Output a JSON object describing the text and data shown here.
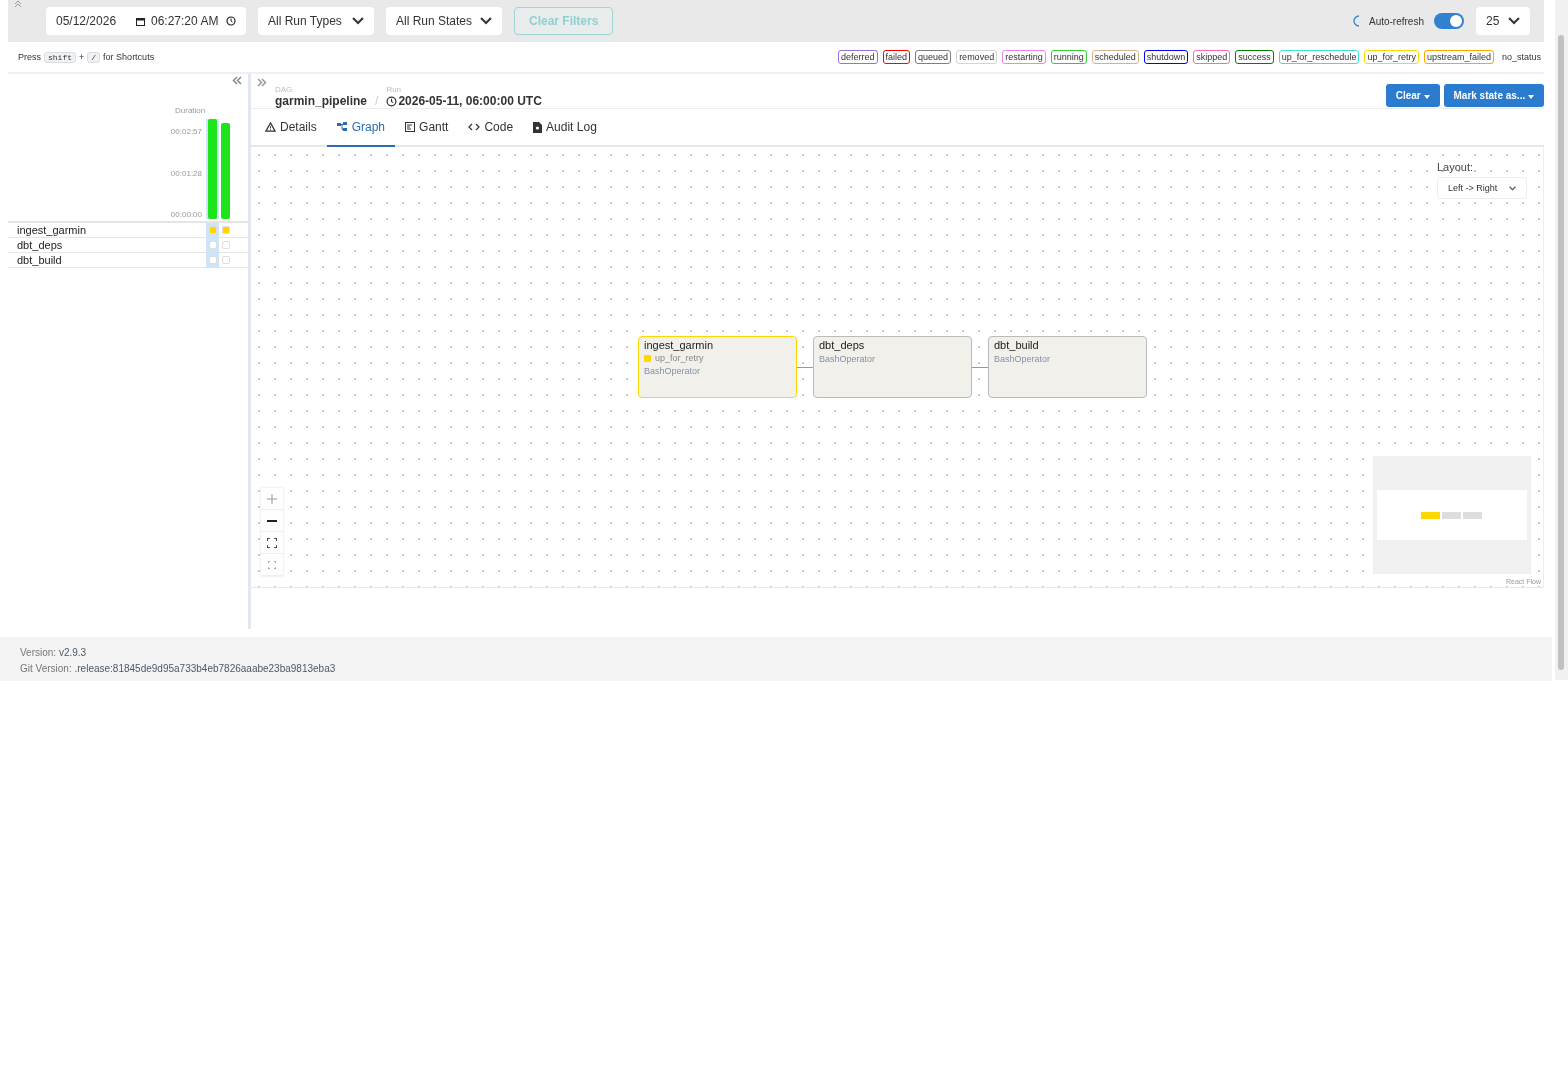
{
  "filters": {
    "date": "05/12/2026",
    "time": "06:27:20 AM",
    "run_type": "All Run Types",
    "run_state": "All Run States",
    "clear_button": "Clear Filters",
    "auto_refresh": {
      "label": "Auto-refresh",
      "on": true
    },
    "page_size": "25"
  },
  "shortcuts": {
    "press": "Press",
    "key1": "shift",
    "plus": "+",
    "key2": "/",
    "tail": "for Shortcuts"
  },
  "legend": [
    {
      "label": "deferred",
      "color": "#9370db"
    },
    {
      "label": "failed",
      "color": "#ff0000"
    },
    {
      "label": "queued",
      "color": "#808080"
    },
    {
      "label": "removed",
      "color": "#d3d3d3"
    },
    {
      "label": "restarting",
      "color": "#ee82ee"
    },
    {
      "label": "running",
      "color": "#32cd32"
    },
    {
      "label": "scheduled",
      "color": "#d2b48c"
    },
    {
      "label": "shutdown",
      "color": "#0000ff"
    },
    {
      "label": "skipped",
      "color": "#ff69b4"
    },
    {
      "label": "success",
      "color": "#008000"
    },
    {
      "label": "up_for_reschedule",
      "color": "#40e0d0"
    },
    {
      "label": "up_for_retry",
      "color": "#ffd700"
    },
    {
      "label": "upstream_failed",
      "color": "#ffa500"
    },
    {
      "label": "no_status"
    }
  ],
  "grid": {
    "duration_label": "Duration",
    "ticks": [
      "00:02:57",
      "00:01:28",
      "00:00:00"
    ],
    "runs": [
      {
        "level": 1.0,
        "selected": true
      },
      {
        "level": 0.96,
        "selected": false
      }
    ],
    "tasks": [
      {
        "name": "ingest_garmin",
        "cells": [
          {
            "color": "#ffd700"
          },
          {
            "color": "#ffd700"
          }
        ]
      },
      {
        "name": "dbt_deps",
        "cells": [
          {
            "color": "#ffffff"
          },
          {
            "color": "#ffffff"
          }
        ]
      },
      {
        "name": "dbt_build",
        "cells": [
          {
            "color": "#ffffff"
          },
          {
            "color": "#ffffff"
          }
        ]
      }
    ]
  },
  "breadcrumb": {
    "dag_label": "DAG",
    "dag": "garmin_pipeline",
    "separator": "/",
    "run_label": "Run",
    "run": "2026-05-11, 06:00:00 UTC"
  },
  "actions": [
    "Clear",
    "Mark state as..."
  ],
  "tabs": [
    {
      "label": "Details",
      "kind": "details",
      "selected": false
    },
    {
      "label": "Graph",
      "kind": "graph",
      "selected": true
    },
    {
      "label": "Gantt",
      "kind": "gantt",
      "selected": false
    },
    {
      "label": "Code",
      "kind": "code",
      "selected": false
    },
    {
      "label": "Audit Log",
      "kind": "log",
      "selected": false
    }
  ],
  "graph": {
    "layout_label": "Layout:",
    "layout": "Left -> Right",
    "nodes": [
      {
        "name": "ingest_garmin",
        "state": "up_for_retry",
        "color": "#ffd700",
        "operator": "BashOperator"
      },
      {
        "name": "dbt_deps",
        "operator": "BashOperator"
      },
      {
        "name": "dbt_build",
        "operator": "BashOperator"
      }
    ],
    "attribution": "React Flow"
  },
  "footer": {
    "version_label": "Version:",
    "version": "v2.9.3",
    "git_label": "Git Version:",
    "git": ".release:81845de9d95a733b4eb7826aaabe23ba9813eba3"
  }
}
